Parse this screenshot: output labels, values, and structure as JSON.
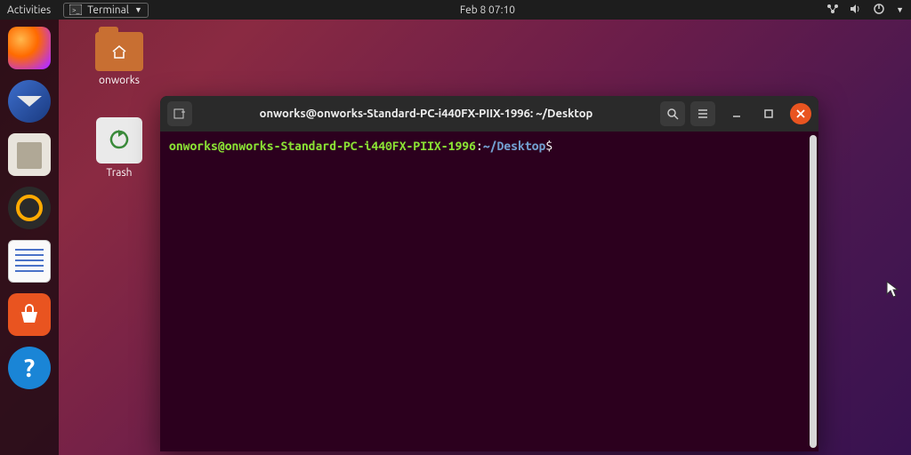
{
  "topbar": {
    "activities": "Activities",
    "app_name": "Terminal",
    "clock": "Feb 8  07:10"
  },
  "desktop": {
    "folder1_label": "onworks",
    "trash_label": "Trash"
  },
  "terminal": {
    "title": "onworks@onworks-Standard-PC-i440FX-PIIX-1996: ~/Desktop",
    "prompt_user_host": "onworks@onworks-Standard-PC-i440FX-PIIX-1996",
    "prompt_colon": ":",
    "prompt_path": "~/Desktop",
    "prompt_dollar": "$"
  },
  "help_glyph": "?"
}
